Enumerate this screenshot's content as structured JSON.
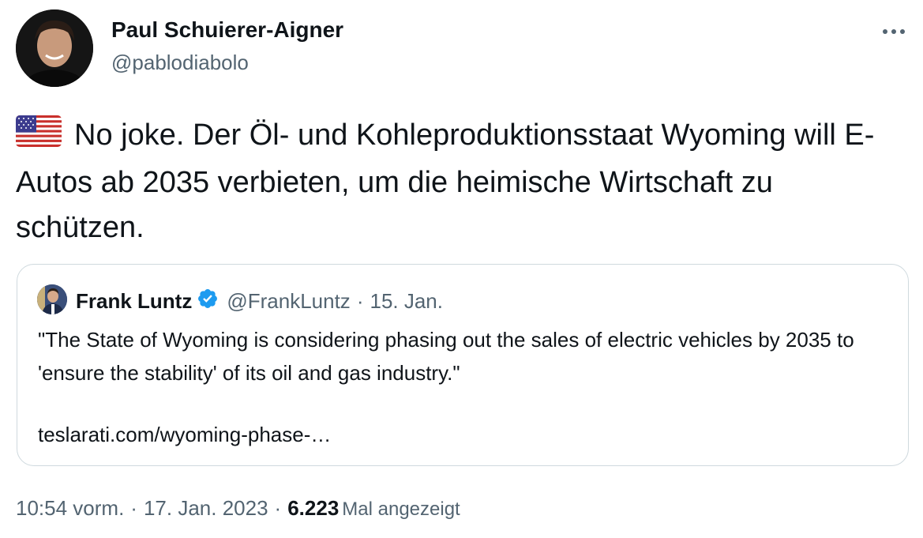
{
  "author": {
    "name": "Paul Schuierer-Aigner",
    "handle": "@pablodiabolo"
  },
  "more_icon": "more-horizontal-icon",
  "tweet": {
    "flag": "us-flag-emoji",
    "text": "No joke. Der Öl- und Kohleproduktionsstaat Wyoming will E-Autos ab 2035 verbieten, um die heimische Wirtschaft zu schützen."
  },
  "quote": {
    "name": "Frank Luntz",
    "verified": "verified-badge-icon",
    "handle": "@FrankLuntz",
    "separator": "·",
    "date": "15. Jan.",
    "text": "\"The State of Wyoming is considering phasing out the sales of electric vehicles by 2035 to 'ensure the stability' of its oil and gas industry.\"",
    "link": "teslarati.com/wyoming-phase-…"
  },
  "meta": {
    "time": "10:54 vorm.",
    "separator": "·",
    "date": "17. Jan. 2023",
    "views_count": "6.223",
    "views_label": "Mal angezeigt"
  },
  "colors": {
    "text": "#0f1419",
    "secondary": "#536471",
    "border": "#cfd9de",
    "verified": "#1d9bf0"
  }
}
